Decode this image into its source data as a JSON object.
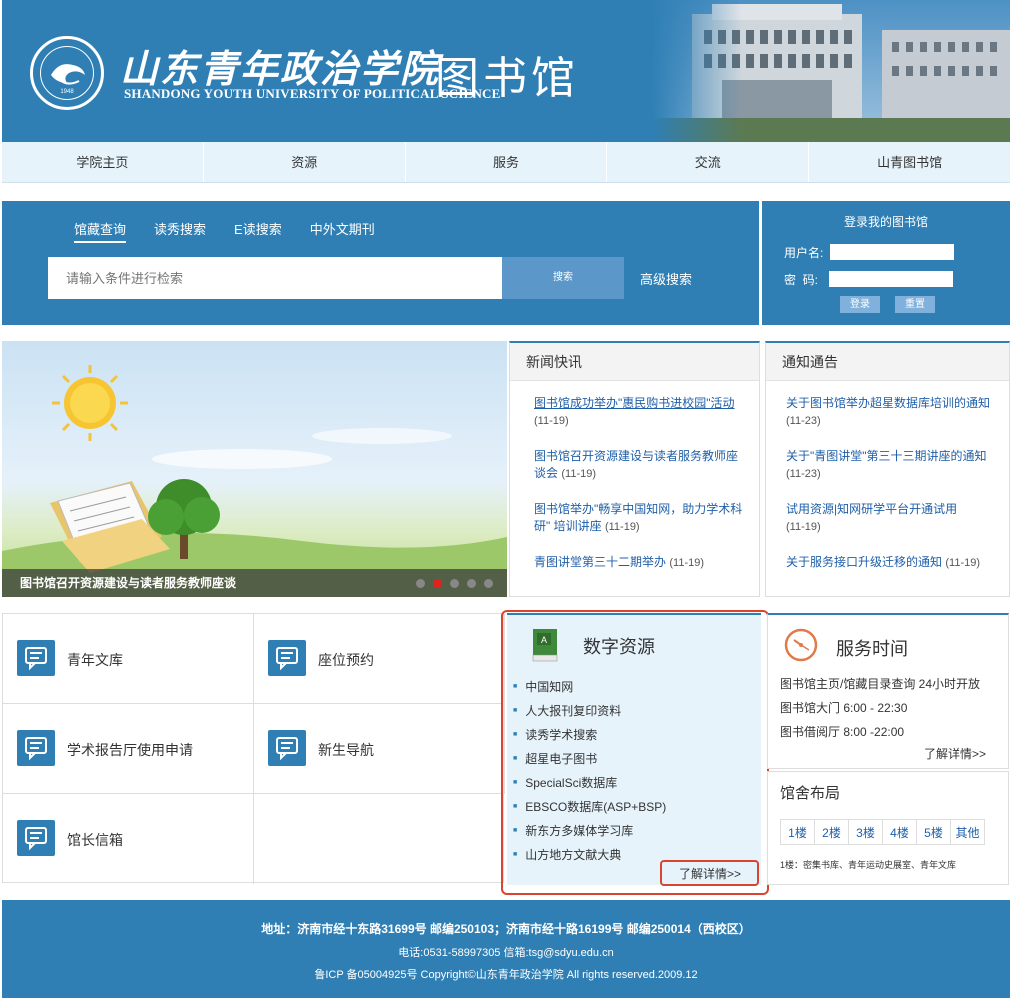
{
  "header": {
    "cn_name": "山东青年政治学院",
    "en_name": "SHANDONG YOUTH UNIVERSITY OF POLITICAL SCIENCE",
    "library_title": "图书馆",
    "seal_year": "1948"
  },
  "nav": {
    "items": [
      {
        "label": "学院主页"
      },
      {
        "label": "资源"
      },
      {
        "label": "服务"
      },
      {
        "label": "交流"
      },
      {
        "label": "山青图书馆"
      }
    ]
  },
  "search": {
    "tabs": [
      {
        "label": "馆藏查询"
      },
      {
        "label": "读秀搜索"
      },
      {
        "label": "E读搜索"
      },
      {
        "label": "中外文期刊"
      }
    ],
    "placeholder": "请输入条件进行检索",
    "button": "搜索",
    "advanced": "高级搜索"
  },
  "login": {
    "title": "登录我的图书馆",
    "username_label": "用户名:",
    "password_label": "密  码:",
    "login_btn": "登录",
    "reset_btn": "重置"
  },
  "banner": {
    "caption": "图书馆召开资源建设与读者服务教师座谈",
    "slide_count": 5,
    "active_slide": 2
  },
  "news": {
    "title": "新闻快讯",
    "items": [
      {
        "text": "图书馆成功举办\"惠民购书进校园\"活动",
        "date": "(11-19)"
      },
      {
        "text": "图书馆召开资源建设与读者服务教师座谈会",
        "date": "(11-19)"
      },
      {
        "text": "图书馆举办\"畅享中国知网，助力学术科研\" 培训讲座",
        "date": "(11-19)"
      },
      {
        "text": "青图讲堂第三十二期举办",
        "date": "(11-19)"
      }
    ]
  },
  "notices": {
    "title": "通知通告",
    "items": [
      {
        "text": "关于图书馆举办超星数据库培训的通知",
        "date": "(11-23)"
      },
      {
        "text": "关于\"青图讲堂\"第三十三期讲座的通知",
        "date": "(11-23)"
      },
      {
        "text": "试用资源|知网研学平台开通试用",
        "date": "(11-19)"
      },
      {
        "text": "关于服务接口升级迁移的通知",
        "date": "(11-19)"
      }
    ]
  },
  "quick_links": [
    {
      "label": "青年文库"
    },
    {
      "label": "座位预约"
    },
    {
      "label": "学术报告厅使用申请"
    },
    {
      "label": "新生导航"
    },
    {
      "label": "馆长信箱"
    }
  ],
  "digital": {
    "title": "数字资源",
    "items": [
      "中国知网",
      "人大报刊复印资料",
      "读秀学术搜索",
      "超星电子图书",
      "SpecialSci数据库",
      "EBSCO数据库(ASP+BSP)",
      "新东方多媒体学习库",
      "山方地方文献大典"
    ],
    "more": "了解详情>>"
  },
  "service": {
    "title": "服务时间",
    "lines": [
      "图书馆主页/馆藏目录查询 24小时开放",
      "图书馆大门 6:00 - 22:30",
      "图书借阅厅 8:00 -22:00"
    ],
    "more": "了解详情>>"
  },
  "floors": {
    "title": "馆舍布局",
    "tabs": [
      "1楼",
      "2楼",
      "3楼",
      "4楼",
      "5楼",
      "其他"
    ],
    "desc": "1楼：密集书库、青年运动史展室、青年文库"
  },
  "footer": {
    "address": "地址：济南市经十东路31699号 邮编250103；济南市经十路16199号 邮编250014（西校区）",
    "contact": "电话:0531-58997305 信箱:tsg@sdyu.edu.cn",
    "copyright": "鲁ICP 备05004925号 Copyright©山东青年政治学院 All rights reserved.2009.12"
  },
  "colors": {
    "brand_blue": "#2f7fb5",
    "highlight_red": "#d9452f",
    "link_blue": "#1f5fa8"
  }
}
